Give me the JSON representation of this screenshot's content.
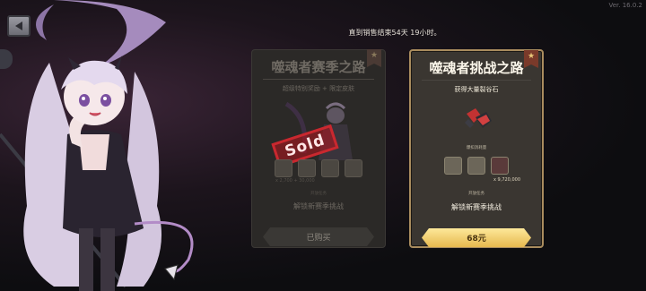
{
  "version": "Ver. 16.0.2",
  "sale_timer": "直到销售结束54天 19小时。",
  "cards": {
    "left": {
      "title": "噬魂者赛季之路",
      "subtitle": "超级特别奖励 + 限定皮肤",
      "stamp": "Sold",
      "mini_label": "开放任务",
      "mini_value_left": "x 2,700 + 30,000",
      "unlock": "解锁新赛季挑战",
      "button": "已购买",
      "badge": "★"
    },
    "right": {
      "title": "噬魂者挑战之路",
      "subtitle": "获得大量裂谷石",
      "mini_label_top": "爆扣消耗量",
      "mini_label_bottom": "开放任务",
      "mini_value": "x 9,720,000",
      "unlock": "解锁新赛季挑战",
      "button": "68元",
      "badge": "★"
    }
  },
  "icons": {
    "back": "back-arrow-icon",
    "badge": "star-badge-icon"
  },
  "colors": {
    "accent_gold": "#e6b84e",
    "sold_red": "#c9282f",
    "card_border": "#a98c5e"
  }
}
